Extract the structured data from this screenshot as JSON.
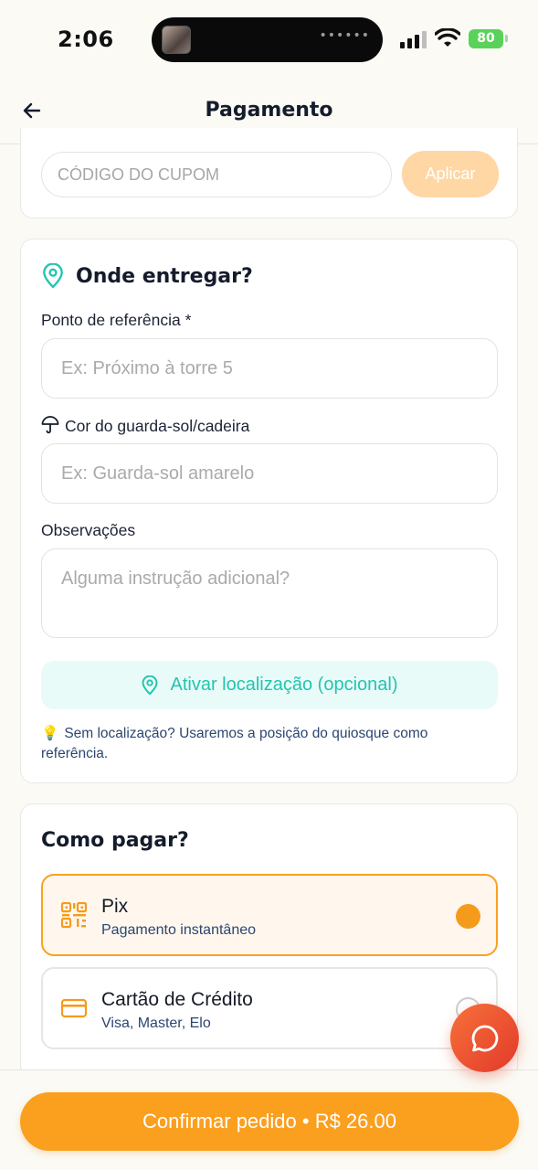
{
  "status_bar": {
    "time": "2:06",
    "battery": "80"
  },
  "header": {
    "title": "Pagamento",
    "back_icon": "arrow-left-icon"
  },
  "coupon": {
    "placeholder": "CÓDIGO DO CUPOM",
    "apply_label": "Aplicar"
  },
  "delivery": {
    "title": "Onde entregar?",
    "reference_label": "Ponto de referência *",
    "reference_placeholder": "Ex: Próximo à torre 5",
    "umbrella_label": "Cor do guarda-sol/cadeira",
    "umbrella_placeholder": "Ex: Guarda-sol amarelo",
    "notes_label": "Observações",
    "notes_placeholder": "Alguma instrução adicional?",
    "location_button": "Ativar localização (opcional)",
    "hint": "Sem localização? Usaremos a posição do quiosque como referência."
  },
  "payment": {
    "title": "Como pagar?",
    "options": [
      {
        "name": "Pix",
        "subtitle": "Pagamento instantâneo",
        "selected": true,
        "icon": "qr-code-icon"
      },
      {
        "name": "Cartão de Crédito",
        "subtitle": "Visa, Master, Elo",
        "selected": false,
        "icon": "credit-card-icon"
      }
    ]
  },
  "footer": {
    "confirm_label": "Confirmar pedido • R$ 26.00"
  },
  "colors": {
    "accent": "#fb9f1f",
    "teal": "#22c5b0",
    "chat_fab": "#e84a2e"
  }
}
